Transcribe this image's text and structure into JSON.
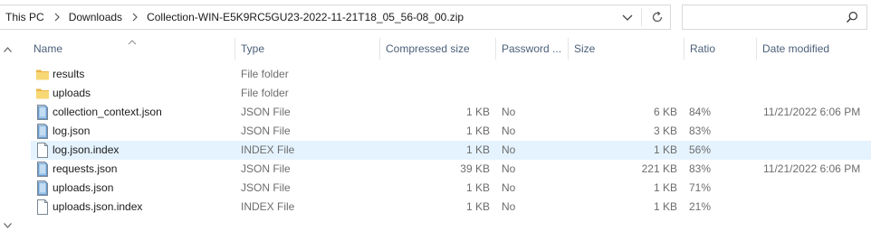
{
  "breadcrumb": {
    "items": [
      "This PC",
      "Downloads",
      "Collection-WIN-E5K9RC5GU23-2022-11-21T18_05_56-08_00.zip"
    ]
  },
  "search": {
    "placeholder": ""
  },
  "columns": {
    "name": "Name",
    "type": "Type",
    "compressed_size": "Compressed size",
    "password": "Password ...",
    "size": "Size",
    "ratio": "Ratio",
    "date_modified": "Date modified"
  },
  "files": [
    {
      "name": "results",
      "type": "File folder",
      "compressed": "",
      "password": "",
      "size": "",
      "ratio": "",
      "date": "",
      "icon": "folder-icon"
    },
    {
      "name": "uploads",
      "type": "File folder",
      "compressed": "",
      "password": "",
      "size": "",
      "ratio": "",
      "date": "",
      "icon": "folder-icon"
    },
    {
      "name": "collection_context.json",
      "type": "JSON File",
      "compressed": "1 KB",
      "password": "No",
      "size": "6 KB",
      "ratio": "84%",
      "date": "11/21/2022 6:06 PM",
      "icon": "json-file-icon"
    },
    {
      "name": "log.json",
      "type": "JSON File",
      "compressed": "1 KB",
      "password": "No",
      "size": "3 KB",
      "ratio": "83%",
      "date": "",
      "icon": "json-file-icon"
    },
    {
      "name": "log.json.index",
      "type": "INDEX File",
      "compressed": "1 KB",
      "password": "No",
      "size": "1 KB",
      "ratio": "56%",
      "date": "",
      "icon": "blank-file-icon"
    },
    {
      "name": "requests.json",
      "type": "JSON File",
      "compressed": "39 KB",
      "password": "No",
      "size": "221 KB",
      "ratio": "83%",
      "date": "11/21/2022 6:06 PM",
      "icon": "json-file-icon"
    },
    {
      "name": "uploads.json",
      "type": "JSON File",
      "compressed": "1 KB",
      "password": "No",
      "size": "1 KB",
      "ratio": "71%",
      "date": "",
      "icon": "json-file-icon"
    },
    {
      "name": "uploads.json.index",
      "type": "INDEX File",
      "compressed": "1 KB",
      "password": "No",
      "size": "1 KB",
      "ratio": "21%",
      "date": "",
      "icon": "blank-file-icon"
    }
  ],
  "colors": {
    "hover_row": "#e5f3ff",
    "folder": "#f8d775",
    "header_text": "#4c607a"
  }
}
